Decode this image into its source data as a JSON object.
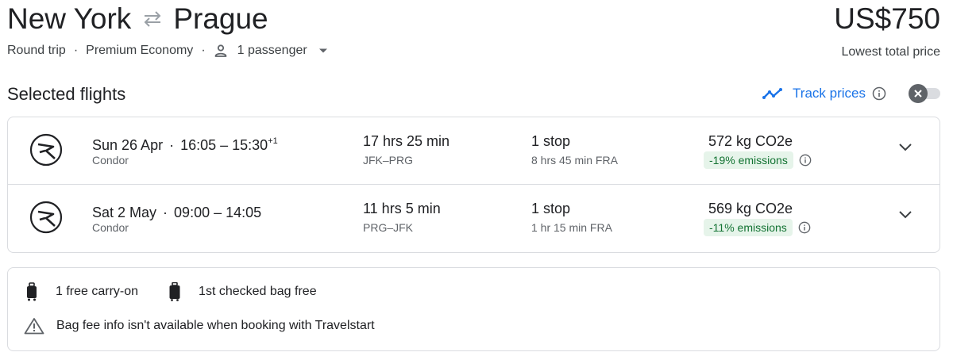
{
  "header": {
    "origin": "New York",
    "destination": "Prague",
    "price": "US$750",
    "price_caption": "Lowest total price",
    "trip_type": "Round trip",
    "cabin_class": "Premium Economy",
    "passengers": "1 passenger",
    "separator": "·"
  },
  "selected": {
    "title": "Selected flights",
    "track_label": "Track prices",
    "track_enabled": false
  },
  "flights": [
    {
      "date": "Sun 26 Apr",
      "separator": "·",
      "times": "16:05 – 15:30",
      "day_offset": "+1",
      "airline": "Condor",
      "duration": "17 hrs 25 min",
      "airports": "JFK–PRG",
      "stops": "1 stop",
      "layover": "8 hrs 45 min FRA",
      "co2": "572 kg CO2e",
      "emissions": "-19% emissions"
    },
    {
      "date": "Sat 2 May",
      "separator": "·",
      "times": "09:00 – 14:05",
      "day_offset": "",
      "airline": "Condor",
      "duration": "11 hrs 5 min",
      "airports": "PRG–JFK",
      "stops": "1 stop",
      "layover": "1 hr 15 min FRA",
      "co2": "569 kg CO2e",
      "emissions": "-11% emissions"
    }
  ],
  "baggage": {
    "carry_on": "1 free carry-on",
    "checked": "1st checked bag free",
    "warning": "Bag fee info isn't available when booking with Travelstart"
  },
  "colors": {
    "accent": "#1a73e8",
    "emissions_bg": "#e6f4ea",
    "emissions_text": "#137333",
    "border": "#dadce0"
  }
}
